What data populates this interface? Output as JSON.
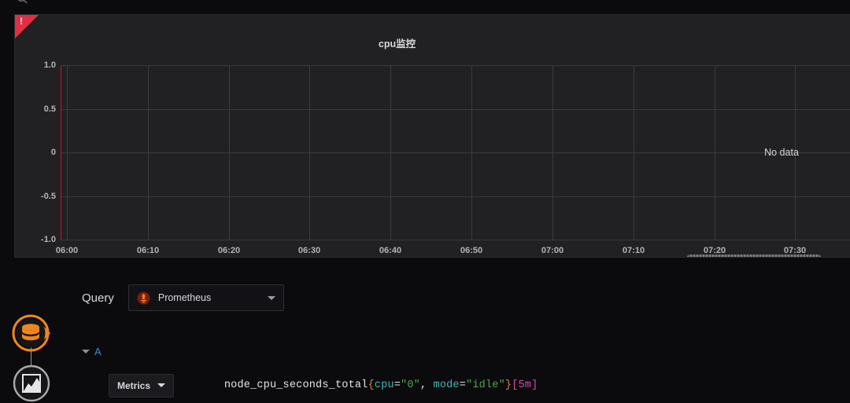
{
  "panel": {
    "title": "cpu监控",
    "alert_indicator": "alert-triangle-icon",
    "no_data_text": "No data",
    "y_axis": {
      "ticks": [
        "1.0",
        "0.5",
        "0",
        "-0.5",
        "-1.0"
      ],
      "values": [
        1.0,
        0.5,
        0,
        -0.5,
        -1.0
      ]
    },
    "x_axis": {
      "ticks": [
        "06:00",
        "06:10",
        "06:20",
        "06:30",
        "06:40",
        "06:50",
        "07:00",
        "07:10",
        "07:20",
        "07:30"
      ]
    }
  },
  "editor": {
    "query_label": "Query",
    "datasource": {
      "name": "Prometheus",
      "icon": "prometheus-icon",
      "caret": "chevron-down-icon"
    },
    "query_row": {
      "ref_id": "A",
      "collapse_caret": "chevron-down-icon",
      "metrics_button": "Metrics",
      "expression": {
        "metric": "node_cpu_seconds_total",
        "open_brace": "{",
        "label1_key": "cpu",
        "label1_op": "=",
        "label1_value": "\"0\"",
        "separator": ", ",
        "label2_key": "mode",
        "label2_op": "=",
        "label2_value": "\"idle\"",
        "close_brace": "}",
        "range": "[5m]",
        "full": "node_cpu_seconds_total{cpu=\"0\", mode=\"idle\"}[5m]"
      }
    }
  },
  "rail": {
    "datasource_node": "database-icon",
    "panel_node": "graph-panel-icon"
  },
  "colors": {
    "page_bg": "#0b0b0d",
    "panel_bg": "#212124",
    "alert_red": "#e02f44",
    "annotation_red": "#c4162a",
    "accent_orange": "#f0861e",
    "query_blue": "#3d8cd4",
    "grid": "#3a3a40"
  },
  "chart_data": {
    "type": "line",
    "title": "cpu监控",
    "xlabel": "",
    "ylabel": "",
    "series": [],
    "x": [
      "06:00",
      "06:10",
      "06:20",
      "06:30",
      "06:40",
      "06:50",
      "07:00",
      "07:10",
      "07:20",
      "07:30"
    ],
    "ylim": [
      -1.0,
      1.0
    ],
    "yticks": [
      -1.0,
      -0.5,
      0,
      0.5,
      1.0
    ],
    "grid": true,
    "legend": "none",
    "annotations": [
      "No data"
    ]
  }
}
